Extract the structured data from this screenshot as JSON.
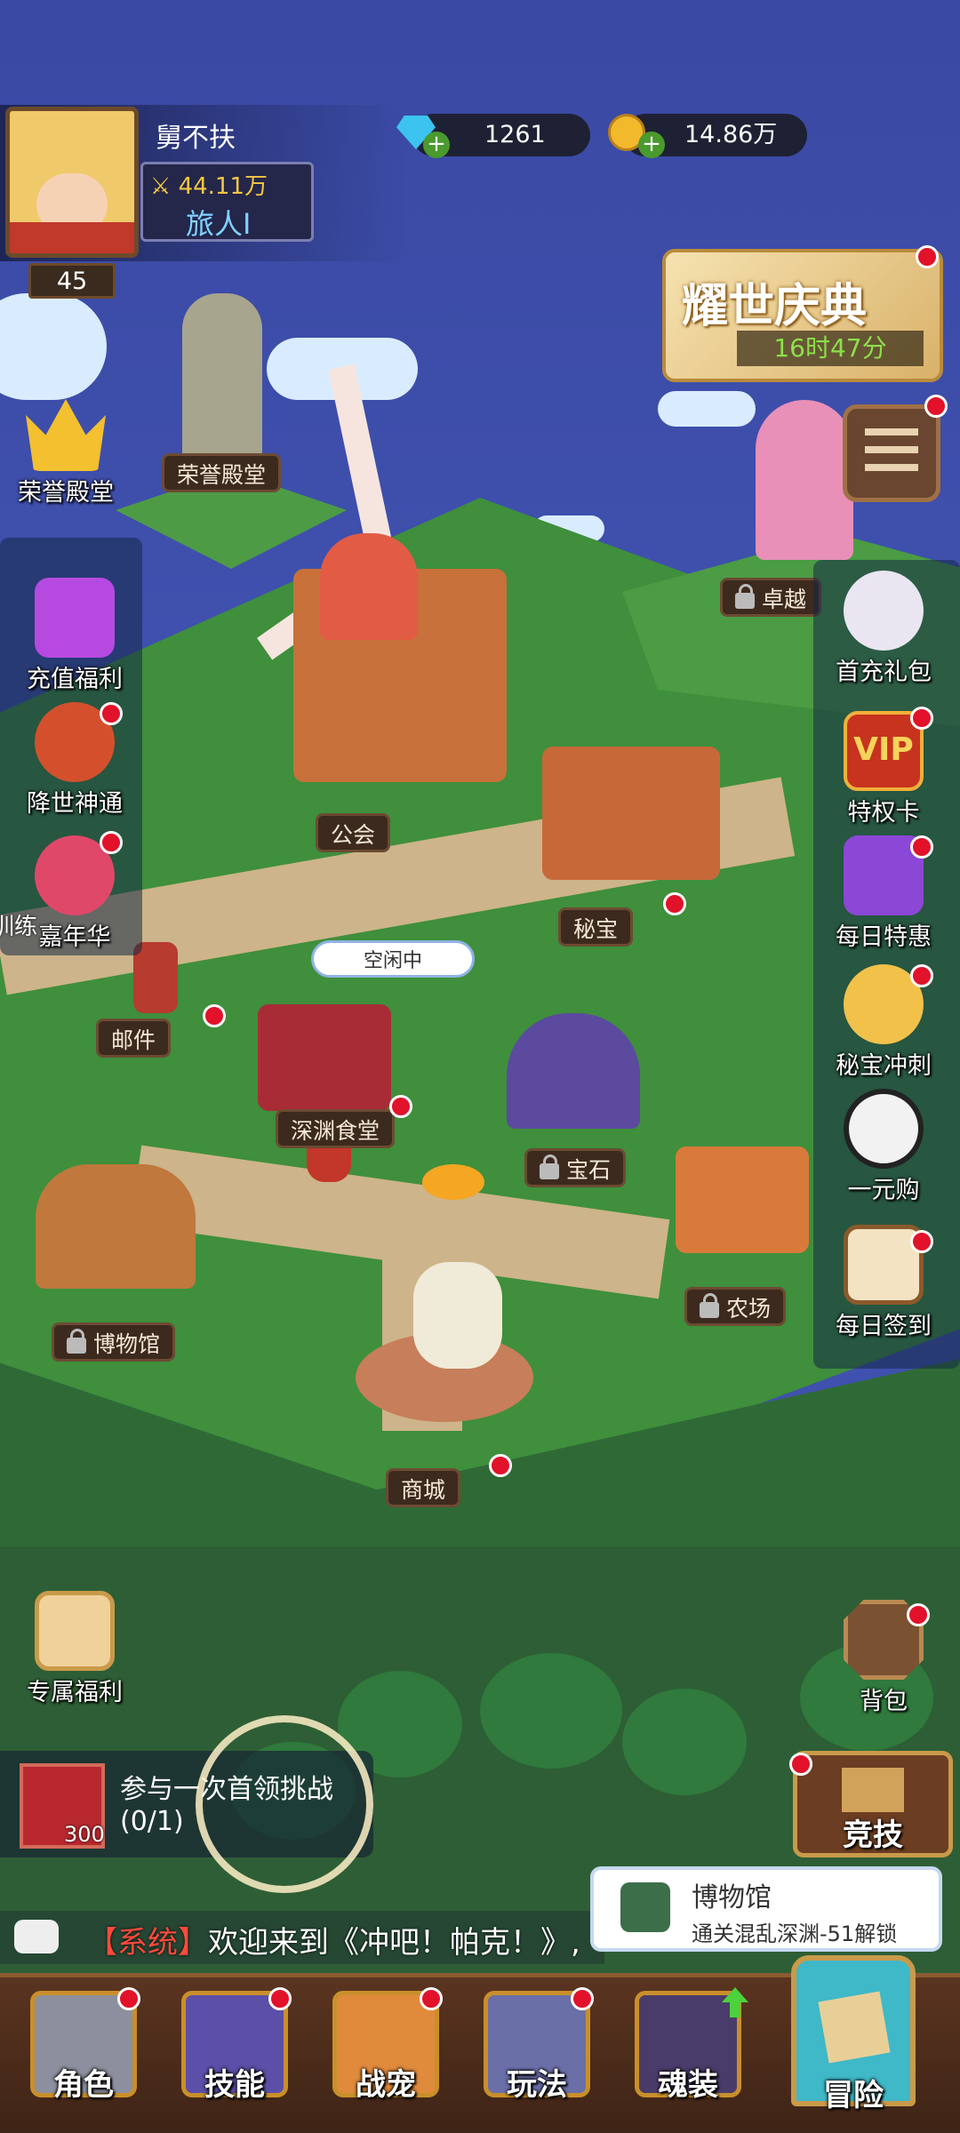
{
  "player": {
    "name": "舅不扶",
    "level": "45",
    "power": "44.11万",
    "title": "旅人I"
  },
  "resources": {
    "diamonds": "1261",
    "gold": "14.86万"
  },
  "event": {
    "title": "耀世庆典",
    "timer": "16时47分"
  },
  "left_menu": {
    "honor_hall": "荣誉殿堂",
    "recharge": "充值福利",
    "god": "降世神通",
    "carnival": "嘉年华",
    "training": "训练",
    "exclusive": "专属福利"
  },
  "right_menu": {
    "first_recharge": "首充礼包",
    "vip_badge": "VIP",
    "privilege": "特权卡",
    "daily_deal": "每日特惠",
    "treasure_rush": "秘宝冲刺",
    "one_yuan": "一元购",
    "daily_signin": "每日签到",
    "backpack": "背包",
    "arena": "竞技"
  },
  "map_labels": {
    "honor_hall": "荣誉殿堂",
    "guild": "公会",
    "treasure": "秘宝",
    "mail": "邮件",
    "idle": "空闲中",
    "canteen": "深渊食堂",
    "gem": "宝石",
    "farm": "农场",
    "museum": "博物馆",
    "mall": "商城",
    "excellence": "卓越"
  },
  "quest": {
    "count": "300",
    "title": "参与一次首领挑战",
    "progress": "(0/1)"
  },
  "chat": {
    "tag": "【系统】",
    "message": "欢迎来到《冲吧！帕克！》,"
  },
  "tooltip": {
    "title": "博物馆",
    "desc": "通关混乱深渊-51解锁"
  },
  "bottom_nav": {
    "role": "角色",
    "skill": "技能",
    "pet": "战宠",
    "play": "玩法",
    "soul": "魂装",
    "adventure": "冒险"
  }
}
